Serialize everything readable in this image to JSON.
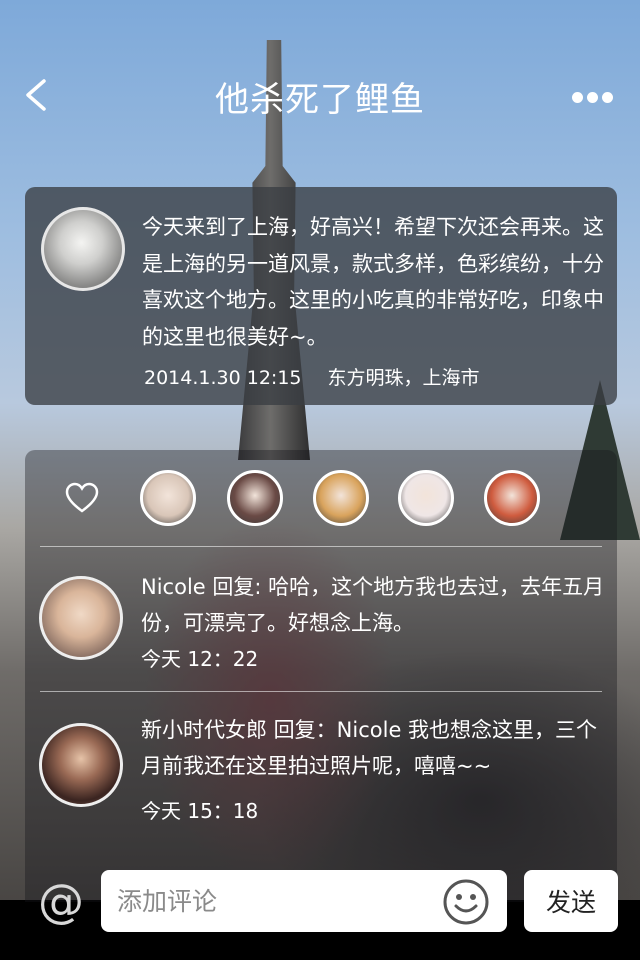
{
  "header": {
    "title": "他杀死了鲤鱼",
    "back_icon": "chevron-left-icon",
    "more_icon": "more-dots-icon"
  },
  "post": {
    "text": "今天来到了上海，好高兴！希望下次还会再来。这是上海的另一道风景，款式多样，色彩缤纷，十分喜欢这个地方。这里的小吃真的非常好吃，印象中的这里也很美好~。",
    "time": "2014.1.30 12:15",
    "location": "东方明珠，上海市"
  },
  "likes": {
    "heart_icon": "heart-outline-icon",
    "liker_colors": [
      "#d9c6b8",
      "#6a4a45",
      "#d9a35c",
      "#efe6e6",
      "#cf5b3e"
    ]
  },
  "comments": [
    {
      "author": "Nicole",
      "text": "Nicole 回复: 哈哈，这个地方我也去过，去年五月份，可漂亮了。好想念上海。",
      "time": "今天 12：22"
    },
    {
      "author": "新小时代女郎",
      "text": "新小时代女郎 回复：Nicole 我也想念这里，三个月前我还在这里拍过照片呢，嘻嘻~~",
      "time": "今天 15：18"
    }
  ],
  "input_bar": {
    "at_symbol": "@",
    "placeholder": "添加评论",
    "smile_icon": "smile-icon",
    "send_label": "发送"
  }
}
